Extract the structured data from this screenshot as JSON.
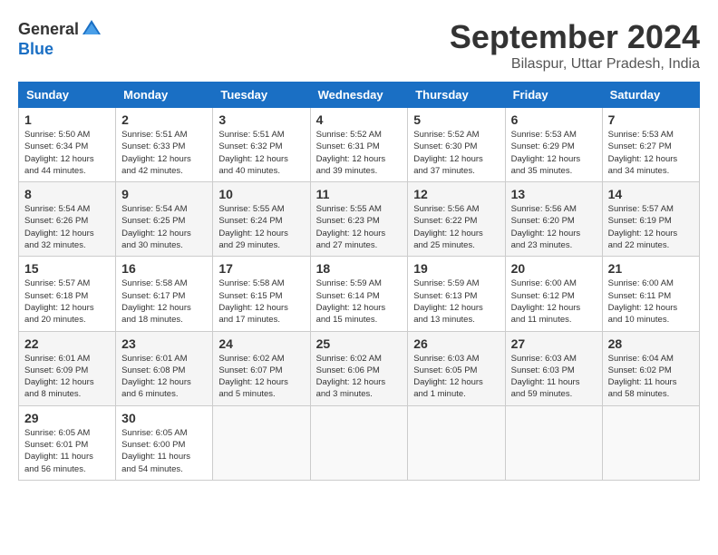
{
  "logo": {
    "general": "General",
    "blue": "Blue"
  },
  "header": {
    "month": "September 2024",
    "location": "Bilaspur, Uttar Pradesh, India"
  },
  "days_of_week": [
    "Sunday",
    "Monday",
    "Tuesday",
    "Wednesday",
    "Thursday",
    "Friday",
    "Saturday"
  ],
  "weeks": [
    [
      {
        "day": "1",
        "info": "Sunrise: 5:50 AM\nSunset: 6:34 PM\nDaylight: 12 hours\nand 44 minutes."
      },
      {
        "day": "2",
        "info": "Sunrise: 5:51 AM\nSunset: 6:33 PM\nDaylight: 12 hours\nand 42 minutes."
      },
      {
        "day": "3",
        "info": "Sunrise: 5:51 AM\nSunset: 6:32 PM\nDaylight: 12 hours\nand 40 minutes."
      },
      {
        "day": "4",
        "info": "Sunrise: 5:52 AM\nSunset: 6:31 PM\nDaylight: 12 hours\nand 39 minutes."
      },
      {
        "day": "5",
        "info": "Sunrise: 5:52 AM\nSunset: 6:30 PM\nDaylight: 12 hours\nand 37 minutes."
      },
      {
        "day": "6",
        "info": "Sunrise: 5:53 AM\nSunset: 6:29 PM\nDaylight: 12 hours\nand 35 minutes."
      },
      {
        "day": "7",
        "info": "Sunrise: 5:53 AM\nSunset: 6:27 PM\nDaylight: 12 hours\nand 34 minutes."
      }
    ],
    [
      {
        "day": "8",
        "info": "Sunrise: 5:54 AM\nSunset: 6:26 PM\nDaylight: 12 hours\nand 32 minutes."
      },
      {
        "day": "9",
        "info": "Sunrise: 5:54 AM\nSunset: 6:25 PM\nDaylight: 12 hours\nand 30 minutes."
      },
      {
        "day": "10",
        "info": "Sunrise: 5:55 AM\nSunset: 6:24 PM\nDaylight: 12 hours\nand 29 minutes."
      },
      {
        "day": "11",
        "info": "Sunrise: 5:55 AM\nSunset: 6:23 PM\nDaylight: 12 hours\nand 27 minutes."
      },
      {
        "day": "12",
        "info": "Sunrise: 5:56 AM\nSunset: 6:22 PM\nDaylight: 12 hours\nand 25 minutes."
      },
      {
        "day": "13",
        "info": "Sunrise: 5:56 AM\nSunset: 6:20 PM\nDaylight: 12 hours\nand 23 minutes."
      },
      {
        "day": "14",
        "info": "Sunrise: 5:57 AM\nSunset: 6:19 PM\nDaylight: 12 hours\nand 22 minutes."
      }
    ],
    [
      {
        "day": "15",
        "info": "Sunrise: 5:57 AM\nSunset: 6:18 PM\nDaylight: 12 hours\nand 20 minutes."
      },
      {
        "day": "16",
        "info": "Sunrise: 5:58 AM\nSunset: 6:17 PM\nDaylight: 12 hours\nand 18 minutes."
      },
      {
        "day": "17",
        "info": "Sunrise: 5:58 AM\nSunset: 6:15 PM\nDaylight: 12 hours\nand 17 minutes."
      },
      {
        "day": "18",
        "info": "Sunrise: 5:59 AM\nSunset: 6:14 PM\nDaylight: 12 hours\nand 15 minutes."
      },
      {
        "day": "19",
        "info": "Sunrise: 5:59 AM\nSunset: 6:13 PM\nDaylight: 12 hours\nand 13 minutes."
      },
      {
        "day": "20",
        "info": "Sunrise: 6:00 AM\nSunset: 6:12 PM\nDaylight: 12 hours\nand 11 minutes."
      },
      {
        "day": "21",
        "info": "Sunrise: 6:00 AM\nSunset: 6:11 PM\nDaylight: 12 hours\nand 10 minutes."
      }
    ],
    [
      {
        "day": "22",
        "info": "Sunrise: 6:01 AM\nSunset: 6:09 PM\nDaylight: 12 hours\nand 8 minutes."
      },
      {
        "day": "23",
        "info": "Sunrise: 6:01 AM\nSunset: 6:08 PM\nDaylight: 12 hours\nand 6 minutes."
      },
      {
        "day": "24",
        "info": "Sunrise: 6:02 AM\nSunset: 6:07 PM\nDaylight: 12 hours\nand 5 minutes."
      },
      {
        "day": "25",
        "info": "Sunrise: 6:02 AM\nSunset: 6:06 PM\nDaylight: 12 hours\nand 3 minutes."
      },
      {
        "day": "26",
        "info": "Sunrise: 6:03 AM\nSunset: 6:05 PM\nDaylight: 12 hours\nand 1 minute."
      },
      {
        "day": "27",
        "info": "Sunrise: 6:03 AM\nSunset: 6:03 PM\nDaylight: 11 hours\nand 59 minutes."
      },
      {
        "day": "28",
        "info": "Sunrise: 6:04 AM\nSunset: 6:02 PM\nDaylight: 11 hours\nand 58 minutes."
      }
    ],
    [
      {
        "day": "29",
        "info": "Sunrise: 6:05 AM\nSunset: 6:01 PM\nDaylight: 11 hours\nand 56 minutes."
      },
      {
        "day": "30",
        "info": "Sunrise: 6:05 AM\nSunset: 6:00 PM\nDaylight: 11 hours\nand 54 minutes."
      },
      {
        "day": "",
        "info": ""
      },
      {
        "day": "",
        "info": ""
      },
      {
        "day": "",
        "info": ""
      },
      {
        "day": "",
        "info": ""
      },
      {
        "day": "",
        "info": ""
      }
    ]
  ]
}
